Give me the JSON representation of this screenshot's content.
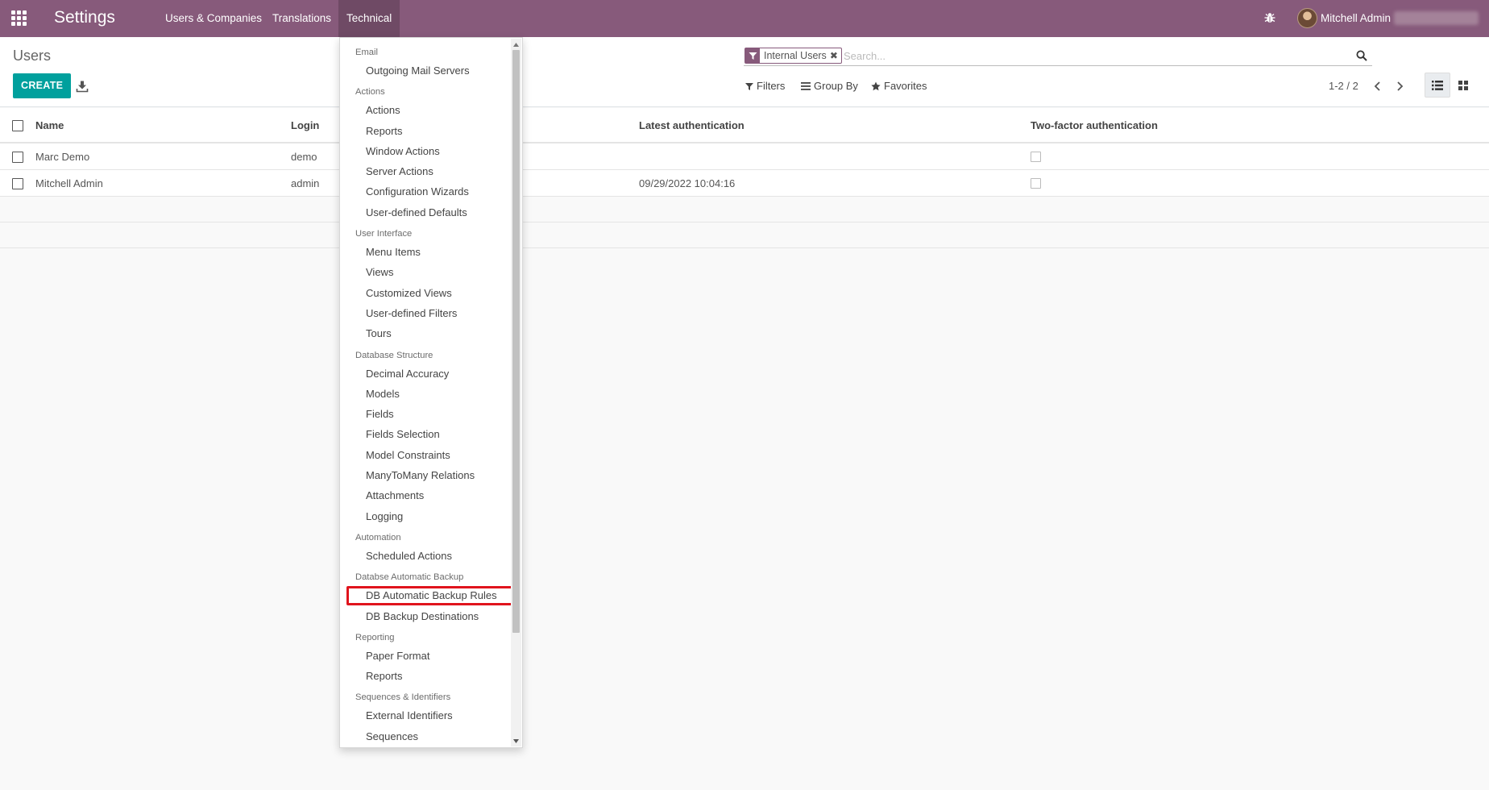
{
  "navbar": {
    "brand": "Settings",
    "menu": [
      {
        "label": "Users & Companies"
      },
      {
        "label": "Translations"
      },
      {
        "label": "Technical"
      }
    ],
    "user_name": "Mitchell Admin",
    "color": "#875a7b"
  },
  "control_panel": {
    "breadcrumb": "Users",
    "create_label": "CREATE",
    "search": {
      "facet_label": "Internal Users",
      "placeholder": "Search..."
    },
    "filters_label": "Filters",
    "group_by_label": "Group By",
    "favorites_label": "Favorites",
    "pager": "1-2 / 2",
    "accent_color": "#00a09d"
  },
  "table": {
    "columns": {
      "name": "Name",
      "login": "Login",
      "latest_auth": "Latest authentication",
      "two_factor": "Two-factor authentication"
    },
    "rows": [
      {
        "name": "Marc Demo",
        "login": "demo",
        "latest_auth": ""
      },
      {
        "name": "Mitchell Admin",
        "login": "admin",
        "latest_auth": "09/29/2022 10:04:16"
      }
    ]
  },
  "technical_menu": {
    "sections": [
      {
        "header": "Email",
        "items": [
          "Outgoing Mail Servers"
        ]
      },
      {
        "header": "Actions",
        "items": [
          "Actions",
          "Reports",
          "Window Actions",
          "Server Actions",
          "Configuration Wizards",
          "User-defined Defaults"
        ]
      },
      {
        "header": "User Interface",
        "items": [
          "Menu Items",
          "Views",
          "Customized Views",
          "User-defined Filters",
          "Tours"
        ]
      },
      {
        "header": "Database Structure",
        "items": [
          "Decimal Accuracy",
          "Models",
          "Fields",
          "Fields Selection",
          "Model Constraints",
          "ManyToMany Relations",
          "Attachments",
          "Logging"
        ]
      },
      {
        "header": "Automation",
        "items": [
          "Scheduled Actions"
        ]
      },
      {
        "header": "Databse Automatic Backup",
        "items": [
          "DB Automatic Backup Rules",
          "DB Backup Destinations"
        ]
      },
      {
        "header": "Reporting",
        "items": [
          "Paper Format",
          "Reports"
        ]
      },
      {
        "header": "Sequences & Identifiers",
        "items": [
          "External Identifiers",
          "Sequences"
        ]
      }
    ],
    "highlighted_item": "DB Automatic Backup Rules",
    "highlight_color": "#e0141d"
  }
}
